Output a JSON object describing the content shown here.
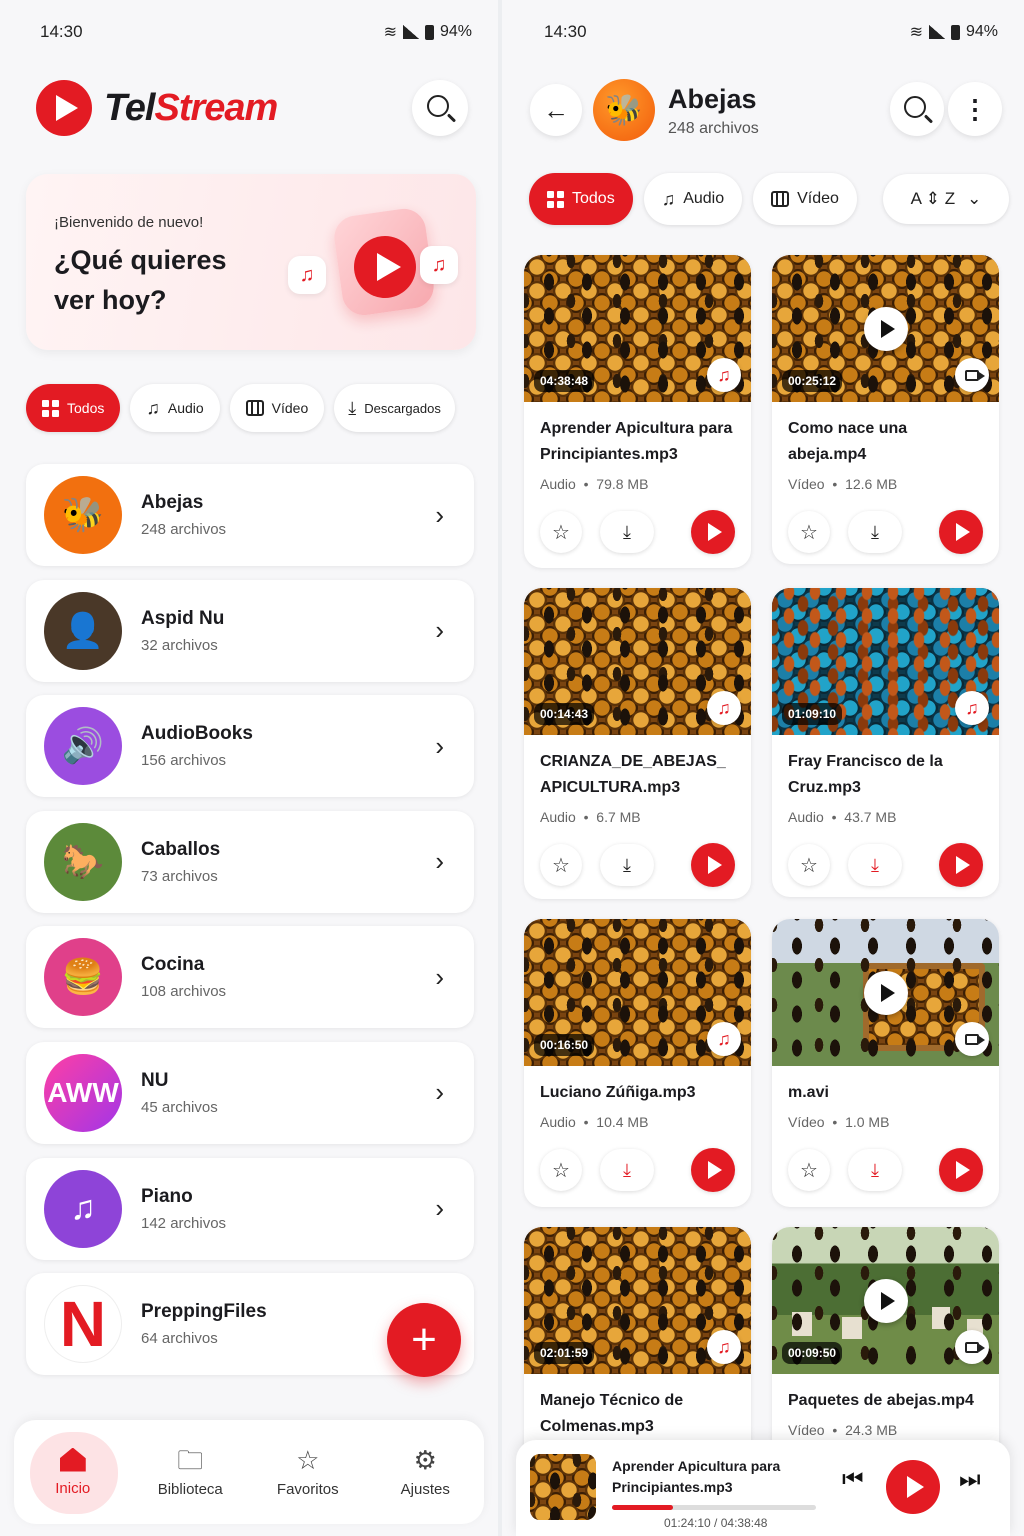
{
  "left": {
    "status": {
      "time": "14:30",
      "battery": "94%"
    },
    "brand": {
      "part1": "Tel",
      "part2": "Stream"
    },
    "hero": {
      "greeting": "¡Bienvenido de nuevo!",
      "question": "¿Qué quieres ver hoy?"
    },
    "filters": [
      {
        "label": "Todos",
        "active": true
      },
      {
        "label": "Audio"
      },
      {
        "label": "Vídeo"
      },
      {
        "label": "Descargados"
      }
    ],
    "folders": [
      {
        "name": "Abejas",
        "count": "248 archivos",
        "icon": "bee-icon",
        "color": "#f2700f"
      },
      {
        "name": "Aspid Nu",
        "count": "32 archivos",
        "icon": "portrait-avatar",
        "color": "#4a3828"
      },
      {
        "name": "AudioBooks",
        "count": "156 archivos",
        "icon": "speaker-icon",
        "color": "#9b4de0"
      },
      {
        "name": "Caballos",
        "count": "73 archivos",
        "icon": "horse-photo",
        "color": "#5c8a3a"
      },
      {
        "name": "Cocina",
        "count": "108 archivos",
        "icon": "burger-icon",
        "color": "#e0408a"
      },
      {
        "name": "NU",
        "count": "45 archivos",
        "icon": "aww-logo",
        "color": "#c43ad6",
        "logo_text": "AWW"
      },
      {
        "name": "Piano",
        "count": "142 archivos",
        "icon": "music-note-icon",
        "color": "#8e44d8"
      },
      {
        "name": "PreppingFiles",
        "count": "64 archivos",
        "icon": "n-logo",
        "color": "#ffffff",
        "logo_text": "N"
      }
    ],
    "fab_label": "+",
    "nav": [
      {
        "label": "Inicio",
        "icon": "home-icon",
        "active": true
      },
      {
        "label": "Biblioteca",
        "icon": "folder-icon"
      },
      {
        "label": "Favoritos",
        "icon": "star-icon"
      },
      {
        "label": "Ajustes",
        "icon": "gear-icon"
      }
    ]
  },
  "right": {
    "status": {
      "time": "14:30",
      "battery": "94%"
    },
    "folder": {
      "title": "Abejas",
      "subtitle": "248 archivos"
    },
    "filters": [
      {
        "label": "Todos",
        "active": true
      },
      {
        "label": "Audio"
      },
      {
        "label": "Vídeo"
      }
    ],
    "sort": {
      "from": "A",
      "to": "Z"
    },
    "files": [
      {
        "duration": "04:38:48",
        "title": "Aprender Apicultura para Principiantes.mp3",
        "type": "Audio",
        "size": "79.8 MB",
        "media": "audio",
        "downloaded": true
      },
      {
        "duration": "00:25:12",
        "title": "Como nace una abeja.mp4",
        "type": "Vídeo",
        "size": "12.6 MB",
        "media": "video",
        "downloaded": true
      },
      {
        "duration": "00:14:43",
        "title": "CRIANZA_DE_ABEJAS_ APICULTURA.mp3",
        "type": "Audio",
        "size": "6.7 MB",
        "media": "audio",
        "downloaded": true
      },
      {
        "duration": "01:09:10",
        "title": "Fray Francisco de la Cruz.mp3",
        "type": "Audio",
        "size": "43.7 MB",
        "media": "audio",
        "downloaded": false
      },
      {
        "duration": "00:16:50",
        "title": "Luciano Zúñiga.mp3",
        "type": "Audio",
        "size": "10.4 MB",
        "media": "audio",
        "downloaded": false
      },
      {
        "duration": "",
        "title": "m.avi",
        "type": "Vídeo",
        "size": "1.0 MB",
        "media": "video",
        "downloaded": false
      },
      {
        "duration": "02:01:59",
        "title": "Manejo Técnico de Colmenas.mp3",
        "type": "Audio",
        "size": "77.4 MB",
        "media": "audio",
        "downloaded": false
      },
      {
        "duration": "00:09:50",
        "title": "Paquetes de abejas.mp4",
        "type": "Vídeo",
        "size": "24.3 MB",
        "media": "video",
        "downloaded": false
      }
    ],
    "player": {
      "title": "Aprender Apicultura para Principiantes.mp3",
      "elapsed": "01:24:10",
      "total": "04:38:48",
      "progress": 0.3
    }
  }
}
